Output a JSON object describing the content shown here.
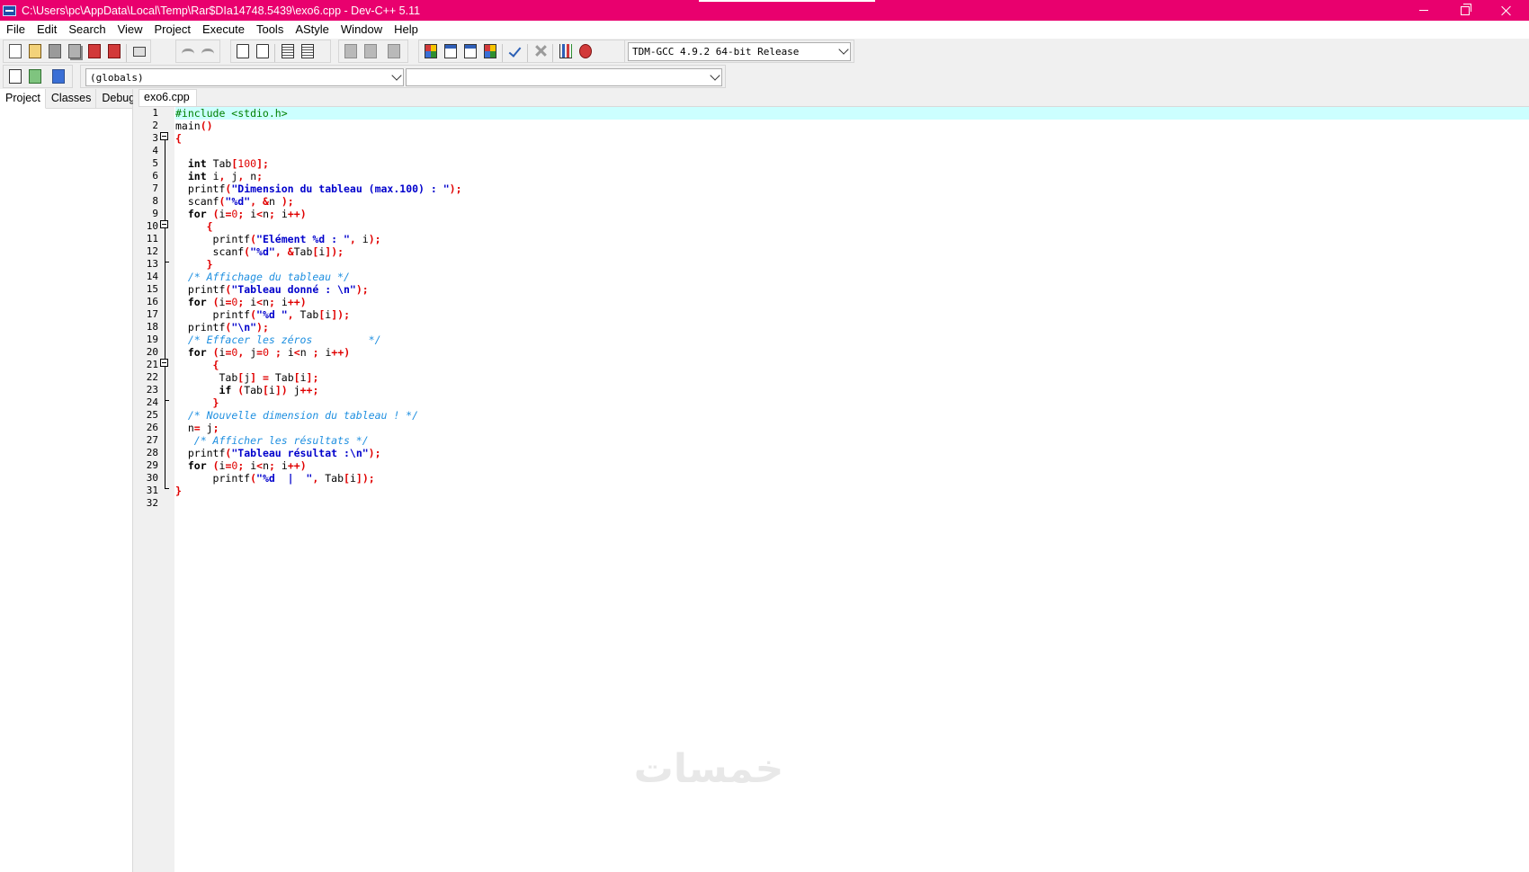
{
  "window": {
    "title": "C:\\Users\\pc\\AppData\\Local\\Temp\\Rar$DIa14748.5439\\exo6.cpp - Dev-C++ 5.11"
  },
  "menu": [
    "File",
    "Edit",
    "Search",
    "View",
    "Project",
    "Execute",
    "Tools",
    "AStyle",
    "Window",
    "Help"
  ],
  "toolbar": {
    "compiler_select": "TDM-GCC 4.9.2 64-bit Release",
    "scope_select": "(globals)",
    "member_select": ""
  },
  "left_tabs": [
    "Project",
    "Classes",
    "Debug"
  ],
  "editor": {
    "file_tab": "exo6.cpp",
    "line_numbers": [
      "1",
      "2",
      "3",
      "4",
      "5",
      "6",
      "7",
      "8",
      "9",
      "10",
      "11",
      "12",
      "13",
      "14",
      "15",
      "16",
      "17",
      "18",
      "19",
      "20",
      "21",
      "22",
      "23",
      "24",
      "25",
      "26",
      "27",
      "28",
      "29",
      "30",
      "31",
      "32"
    ],
    "code": [
      "#include <stdio.h>",
      "main()",
      "{",
      "",
      "  int Tab[100];",
      "  int i, j, n;",
      "  printf(\"Dimension du tableau (max.100) : \");",
      "  scanf(\"%d\", &n );",
      "  for (i=0; i<n; i++)",
      "     {",
      "      printf(\"Elément %d : \", i);",
      "      scanf(\"%d\", &Tab[i]);",
      "     }",
      "  /* Affichage du tableau */",
      "  printf(\"Tableau donné : \\n\");",
      "  for (i=0; i<n; i++)",
      "      printf(\"%d \", Tab[i]);",
      "  printf(\"\\n\");",
      "  /* Effacer les zéros         */",
      "  for (i=0, j=0 ; i<n ; i++)",
      "      {",
      "       Tab[j] = Tab[i];",
      "       if (Tab[i]) j++;",
      "      }",
      "  /* Nouvelle dimension du tableau ! */",
      "  n= j;",
      "   /* Afficher les résultats */",
      "  printf(\"Tableau résultat :\\n\");",
      "  for (i=0; i<n; i++)",
      "      printf(\"%d  |  \", Tab[i]);",
      "}",
      ""
    ]
  },
  "icons": {
    "toolbar_row1": [
      "new-file-icon",
      "open-icon",
      "save-icon",
      "save-all-icon",
      "close-file-icon",
      "close-all-icon",
      "print-icon",
      "undo-icon",
      "redo-icon",
      "find-icon",
      "replace-icon",
      "indent-icon",
      "unindent-icon",
      "goto-back-icon",
      "goto-forward-icon",
      "bookmark-icon",
      "compile-icon",
      "run-icon",
      "compile-run-icon",
      "rebuild-icon",
      "syntax-check-icon",
      "stop-icon",
      "profile-icon",
      "debug-icon"
    ],
    "toolbar_row2": [
      "new-project-icon",
      "add-to-project-icon",
      "remove-from-project-icon"
    ]
  },
  "colors": {
    "titlebar": "#e9006e",
    "current_line": "#ccffff",
    "keyword": "#000000",
    "string": "#0000cc",
    "number": "#e00000",
    "preprocessor": "#008000",
    "comment": "#1e8fe0"
  }
}
